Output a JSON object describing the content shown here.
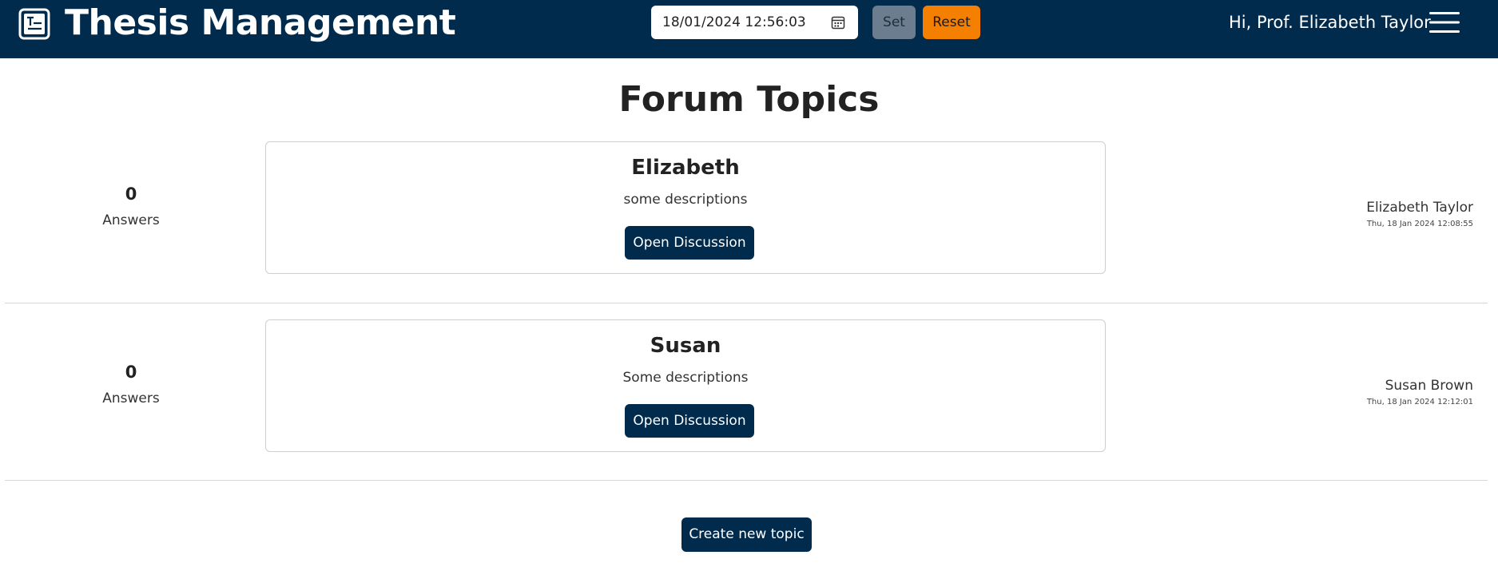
{
  "navbar": {
    "title": "Thesis Management",
    "logo_icon": "thesis-logo-icon",
    "datetime_value": "18/01/2024 12:56:03",
    "calendar_icon": "calendar-icon",
    "set_label": "Set",
    "reset_label": "Reset",
    "greeting": "Hi, Prof. Elizabeth Taylor",
    "menu_icon": "hamburger-menu-icon",
    "colors": {
      "background": "#002b4d",
      "set": "#6b7d8f",
      "reset": "#f57f00"
    }
  },
  "page": {
    "title": "Forum Topics",
    "create_label": "Create new topic"
  },
  "topics": [
    {
      "answers_count": "0",
      "answers_label": "Answers",
      "title": "Elizabeth",
      "description": "some descriptions",
      "open_label": "Open Discussion",
      "author": "Elizabeth Taylor",
      "date": "Thu, 18 Jan 2024 12:08:55"
    },
    {
      "answers_count": "0",
      "answers_label": "Answers",
      "title": "Susan",
      "description": "Some descriptions",
      "open_label": "Open Discussion",
      "author": "Susan Brown",
      "date": "Thu, 18 Jan 2024 12:12:01"
    }
  ]
}
